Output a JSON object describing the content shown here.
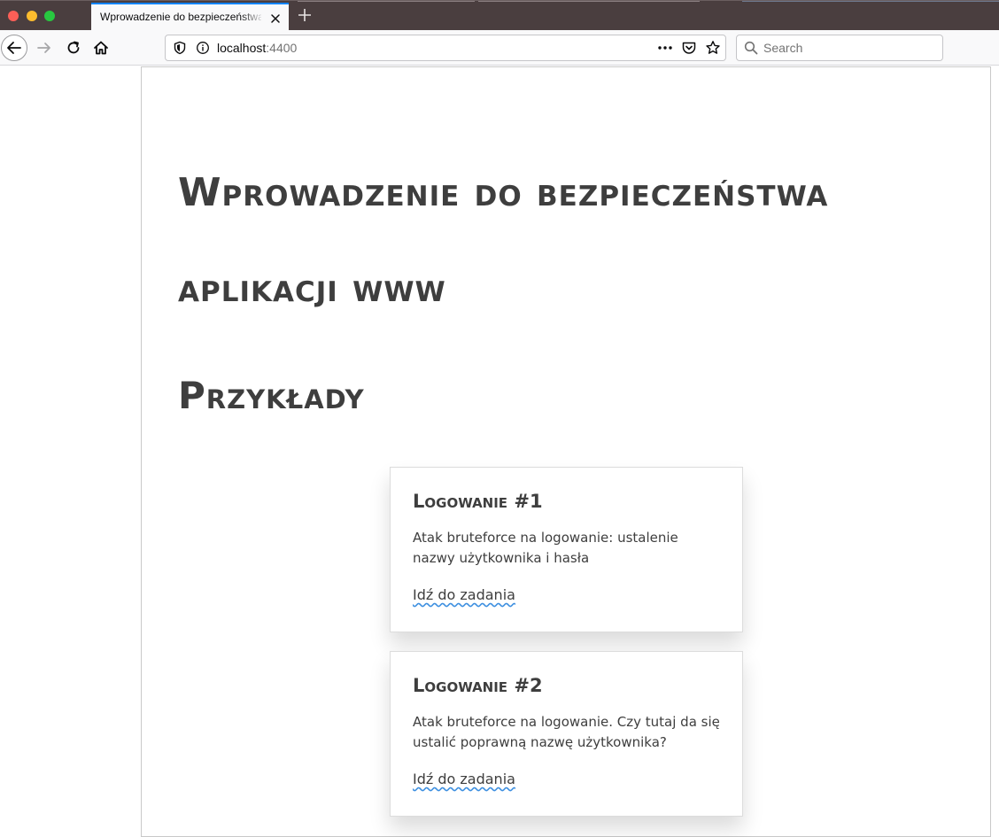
{
  "browser": {
    "tab": {
      "title": "Wprowadzenie do bezpieczeństwa aplikacji www"
    },
    "url": {
      "host": "localhost",
      "port": ":4400"
    },
    "search": {
      "placeholder": "Search"
    }
  },
  "page": {
    "title": "Wprowadzenie do bezpieczeństwa aplikacji www",
    "section_title": "Przykłady",
    "cards": [
      {
        "title": "Logowanie #1",
        "description": "Atak bruteforce na logowanie: ustalenie nazwy użytkownika i hasła",
        "link": "Idź do zadania"
      },
      {
        "title": "Logowanie #2",
        "description": "Atak bruteforce na logowanie. Czy tutaj da się ustalić poprawną nazwę użytkownika?",
        "link": "Idź do zadania"
      }
    ]
  },
  "colors": {
    "text": "#3e3e3e",
    "link_underline": "#3d8fe0",
    "tabbar": "#4a3e3f",
    "tab_accent": "#0a84ff"
  },
  "icons": {
    "back": "back-arrow-icon",
    "forward": "forward-arrow-icon",
    "reload": "reload-icon",
    "home": "home-icon",
    "shield": "tracking-protection-shield-icon",
    "info": "info-icon",
    "more": "page-actions-ellipsis-icon",
    "pocket": "pocket-icon",
    "bookmark": "bookmark-star-icon",
    "search": "search-icon",
    "close_tab": "close-icon",
    "new_tab": "plus-icon"
  }
}
